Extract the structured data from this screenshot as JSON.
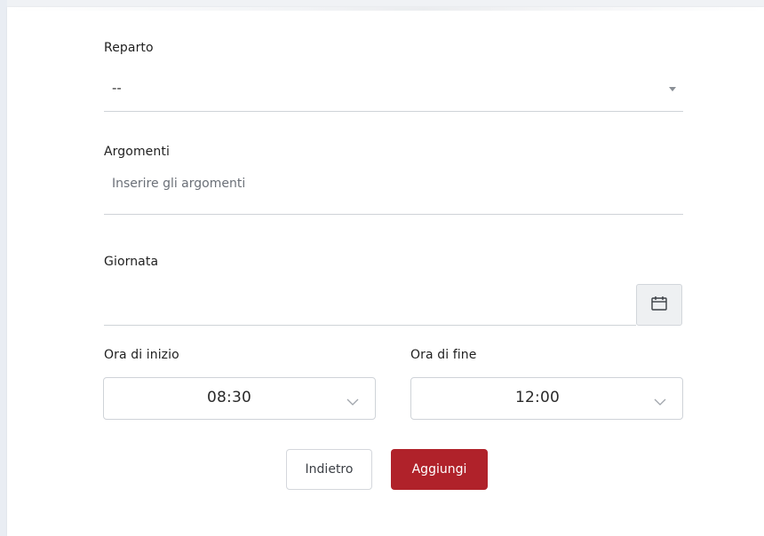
{
  "form": {
    "reparto": {
      "label": "Reparto",
      "value": "--"
    },
    "argomenti": {
      "label": "Argomenti",
      "placeholder": "Inserire gli argomenti"
    },
    "giornata": {
      "label": "Giornata",
      "value": ""
    },
    "ora_inizio": {
      "label": "Ora di inizio",
      "value": "08:30"
    },
    "ora_fine": {
      "label": "Ora di fine",
      "value": "12:00"
    }
  },
  "actions": {
    "back_label": "Indietro",
    "add_label": "Aggiungi"
  },
  "colors": {
    "primary": "#b0222a",
    "border": "#cfd3d8",
    "calendar_bg": "#eef0f2"
  },
  "icons": {
    "select_caret": "caret-down-icon",
    "calendar": "calendar-icon",
    "time_chevron": "chevron-down-icon"
  }
}
